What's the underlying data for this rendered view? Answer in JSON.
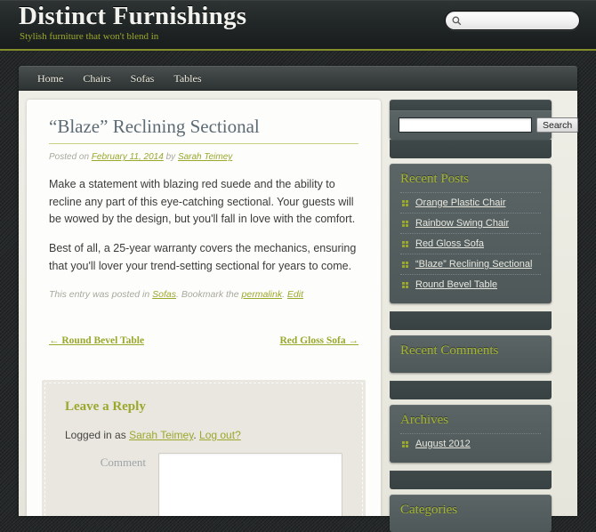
{
  "site": {
    "title": "Distinct Furnishings",
    "description": "Stylish furniture that won't blend in",
    "header_search_placeholder": ""
  },
  "nav": {
    "items": [
      {
        "label": "Home"
      },
      {
        "label": "Chairs"
      },
      {
        "label": "Sofas"
      },
      {
        "label": "Tables"
      }
    ]
  },
  "post": {
    "title": "“Blaze” Reclining Sectional",
    "meta": {
      "posted_on_label": "Posted on",
      "date": "February 11, 2014",
      "by_label": "by",
      "author": "Sarah Teimey"
    },
    "paragraphs": [
      "Make a statement with blazing red suede and the ability to recline any part of this eye-catching sectional. Your guests will be wowed by the design, but you'll fall in love with the comfort.",
      "Best of all, a 25-year warranty covers the mechanics, ensuring that you'll lover your trend-setting sectional for years to come."
    ],
    "utility": {
      "prefix": "This entry was posted in",
      "category": "Sofas",
      "middle": ". Bookmark the",
      "permalink": "permalink",
      "period": ".",
      "edit": "Edit"
    },
    "navigation": {
      "previous": "← Round Bevel Table",
      "next": "Red Gloss Sofa →"
    }
  },
  "comments": {
    "reply_title": "Leave a Reply",
    "logged_in_prefix": "Logged in as",
    "logged_in_user": "Sarah Teimey",
    "logged_in_separator": ".",
    "logout_label": "Log out?",
    "comment_label": "Comment",
    "comment_value": "",
    "comment_placeholder": ""
  },
  "sidebar": {
    "search": {
      "value": "",
      "placeholder": "",
      "submit_label": "Search"
    },
    "widgets": [
      {
        "title": "Recent Posts",
        "items": [
          {
            "label": "Orange Plastic Chair"
          },
          {
            "label": "Rainbow Swing Chair"
          },
          {
            "label": "Red Gloss Sofa"
          },
          {
            "label": "“Blaze” Reclining Sectional"
          },
          {
            "label": "Round Bevel Table"
          }
        ]
      },
      {
        "title": "Recent Comments",
        "items": []
      },
      {
        "title": "Archives",
        "items": [
          {
            "label": "August 2012"
          }
        ]
      },
      {
        "title": "Categories",
        "items": []
      }
    ]
  },
  "colors": {
    "accent_green": "#9aa82c",
    "widget_title_green": "#a5b52e",
    "header_bg": "#1b1f1f",
    "sidebar_widget_bg": "#555f60",
    "page_wrap_bg": "#e7e7dd",
    "title_blue_gray": "#5d6b75"
  }
}
